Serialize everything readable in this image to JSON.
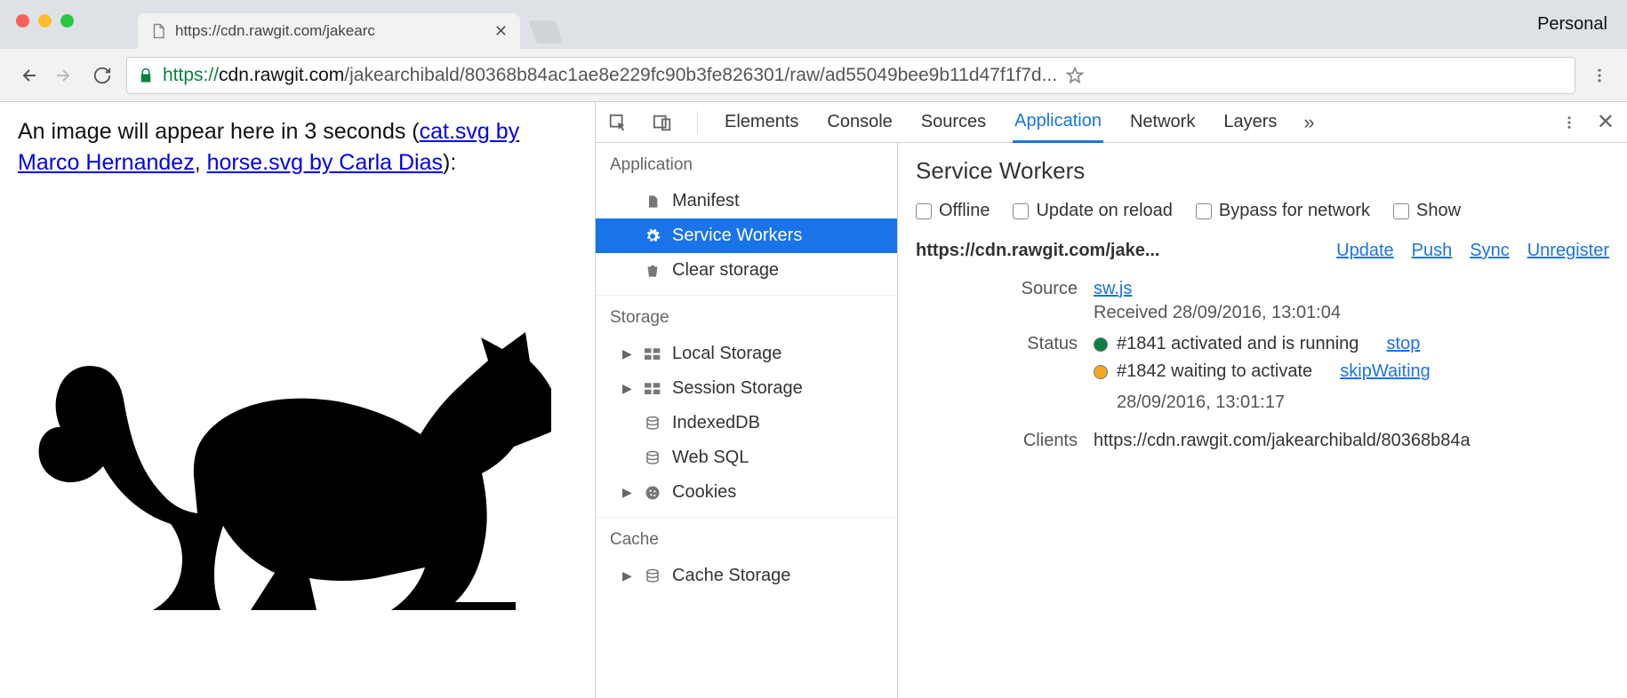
{
  "window": {
    "profile_badge": "Personal",
    "tab_title": "https://cdn.rawgit.com/jakearc",
    "url_display": {
      "scheme": "https",
      "host": "cdn.rawgit.com",
      "rest": "/jakearchibald/80368b84ac1ae8e229fc90b3fe826301/raw/ad55049bee9b11d47f1f7d..."
    }
  },
  "page": {
    "intro_prefix": "An image will appear here in 3 seconds (",
    "link1": "cat.svg by Marco Hernandez",
    "sep": ", ",
    "link2": "horse.svg by Carla Dias",
    "suffix": "):"
  },
  "devtools": {
    "tabs": [
      "Elements",
      "Console",
      "Sources",
      "Application",
      "Network",
      "Layers"
    ],
    "active_tab": "Application",
    "sidebar": {
      "sections": [
        {
          "title": "Application",
          "items": [
            {
              "icon": "manifest",
              "label": "Manifest"
            },
            {
              "icon": "gear",
              "label": "Service Workers",
              "selected": true
            },
            {
              "icon": "trash",
              "label": "Clear storage"
            }
          ]
        },
        {
          "title": "Storage",
          "items": [
            {
              "icon": "db",
              "label": "Local Storage",
              "expandable": true
            },
            {
              "icon": "db",
              "label": "Session Storage",
              "expandable": true
            },
            {
              "icon": "disk",
              "label": "IndexedDB"
            },
            {
              "icon": "disk",
              "label": "Web SQL"
            },
            {
              "icon": "cookie",
              "label": "Cookies",
              "expandable": true
            }
          ]
        },
        {
          "title": "Cache",
          "items": [
            {
              "icon": "disk",
              "label": "Cache Storage",
              "expandable": true
            }
          ]
        }
      ]
    },
    "panel": {
      "title": "Service Workers",
      "checks": [
        "Offline",
        "Update on reload",
        "Bypass for network",
        "Show"
      ],
      "scope": "https://cdn.rawgit.com/jake...",
      "actions": [
        "Update",
        "Push",
        "Sync",
        "Unregister"
      ],
      "source": {
        "file": "sw.js",
        "received": "Received 28/09/2016, 13:01:04"
      },
      "status": [
        {
          "color": "green",
          "text": "#1841 activated and is running",
          "action": "stop"
        },
        {
          "color": "orange",
          "text": "#1842 waiting to activate",
          "action": "skipWaiting",
          "time": "28/09/2016, 13:01:17"
        }
      ],
      "clients": "https://cdn.rawgit.com/jakearchibald/80368b84a",
      "labels": {
        "source": "Source",
        "status": "Status",
        "clients": "Clients"
      }
    }
  }
}
